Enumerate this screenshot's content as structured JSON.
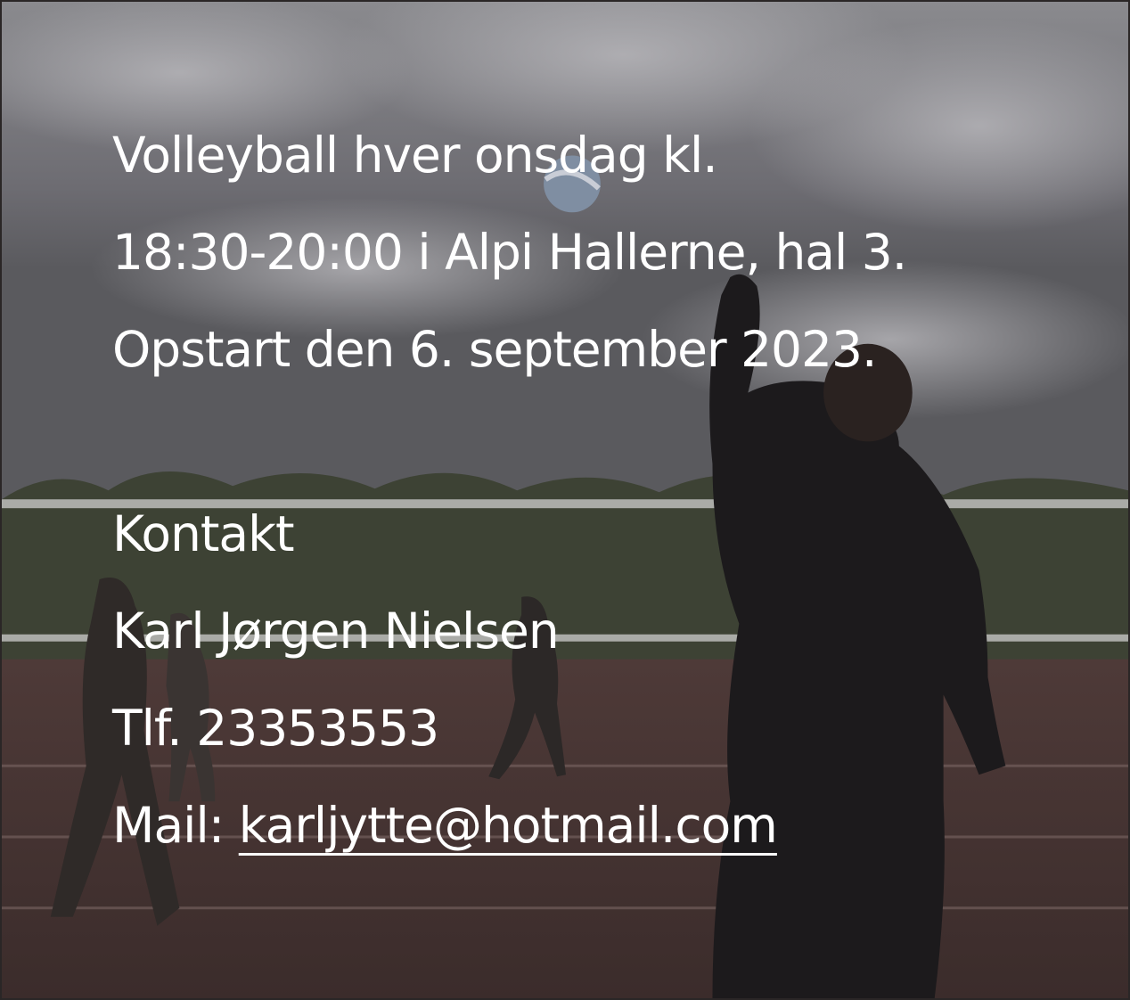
{
  "announcement": {
    "line1": "Volleyball hver onsdag kl.",
    "line2": "18:30-20:00 i Alpi Hallerne, hal 3.",
    "line3": "Opstart den 6. september 2023."
  },
  "contact": {
    "heading": "Kontakt",
    "name": "Karl Jørgen Nielsen",
    "phone": "Tlf. 23353553",
    "mail_label": "Mail: ",
    "mail_address": "karljytte@hotmail.com",
    "mail_href": "mailto:karljytte@hotmail.com"
  },
  "background": {
    "image": "volleyball-players-outdoor-court-photo",
    "overlay_color": "#3c3a3c"
  },
  "colors": {
    "text": "#ffffff"
  }
}
